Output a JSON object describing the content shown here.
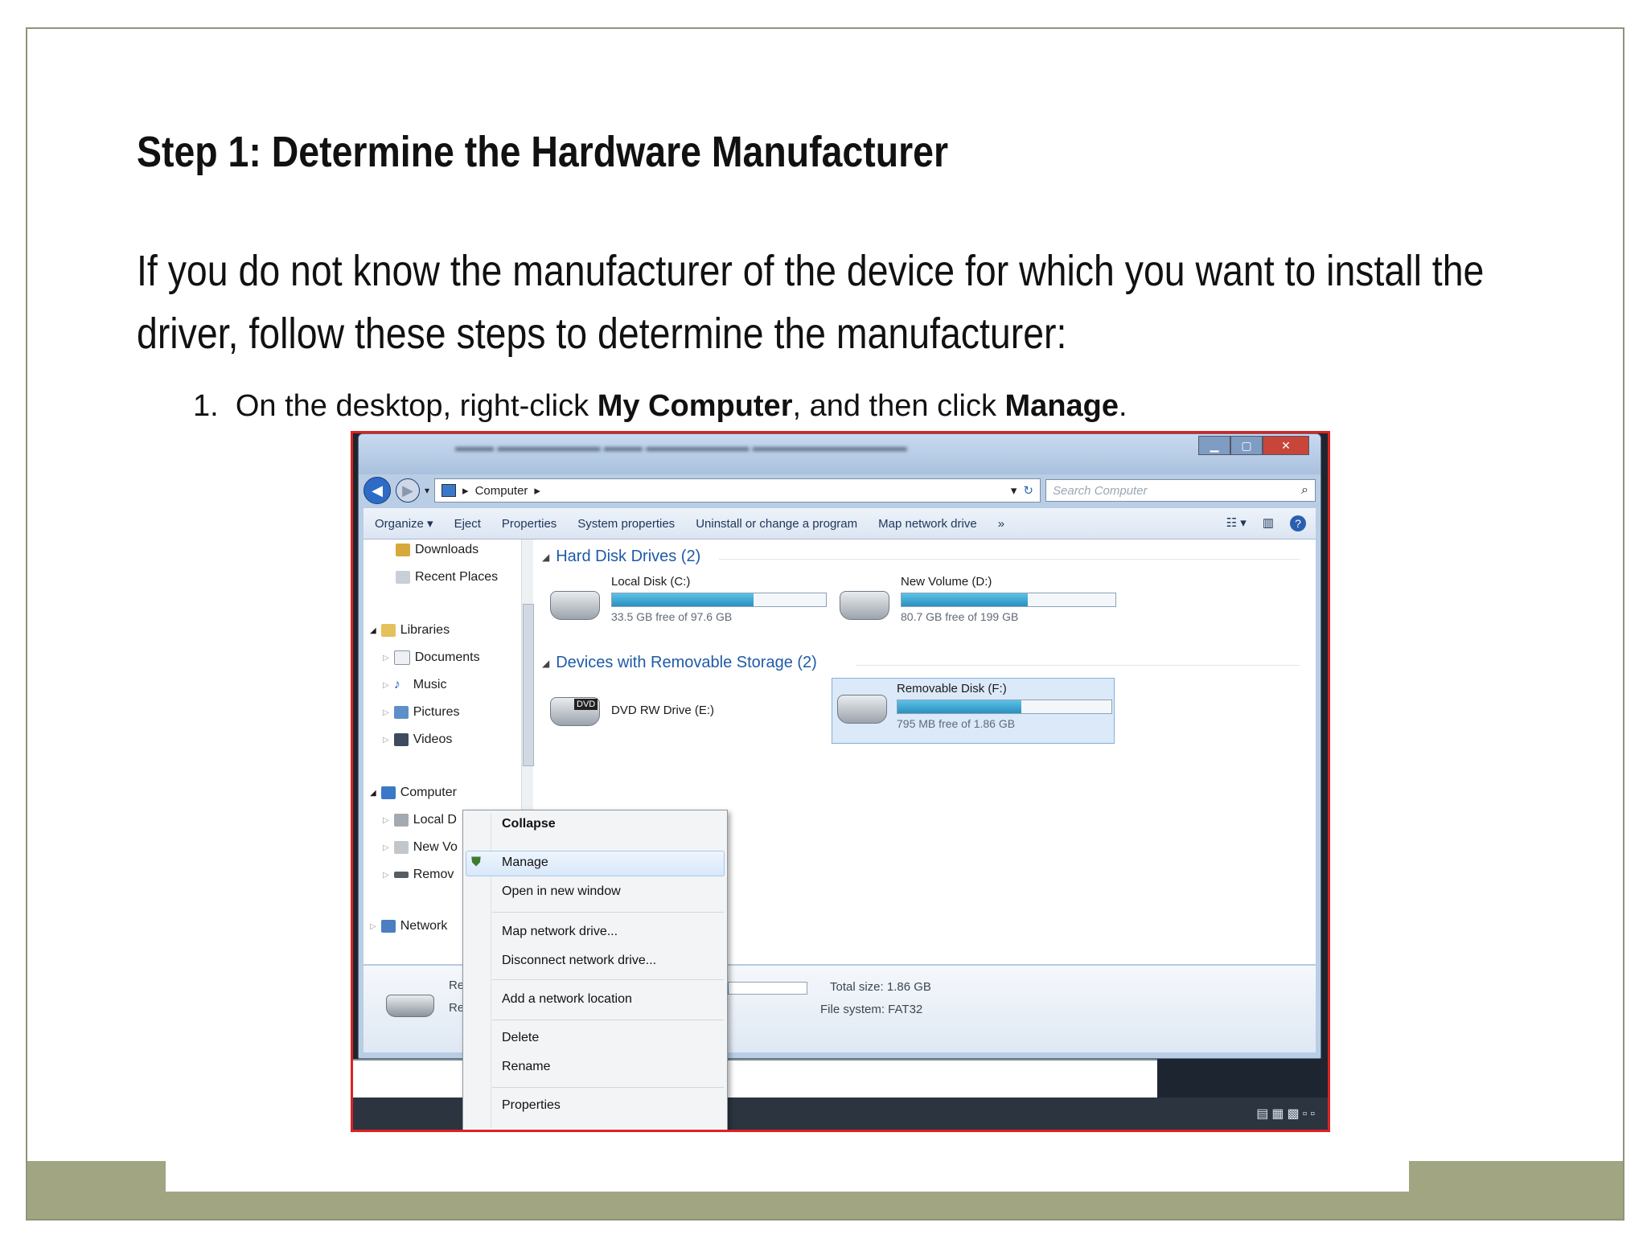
{
  "slide": {
    "title": "Step 1: Determine the Hardware Manufacturer",
    "intro": "If you do not know the manufacturer of the device for which you want to install the driver, follow these steps to determine the manufacturer:",
    "step": {
      "number": "1.",
      "text_before": "On the desktop, right-click ",
      "bold1": "My Computer",
      "text_middle": ", and then click ",
      "bold2": "Manage",
      "text_after": "."
    }
  },
  "explorer": {
    "address": {
      "path": "Computer",
      "separator": "▸"
    },
    "search": {
      "placeholder": "Search Computer"
    },
    "commands": [
      "Organize ▾",
      "Eject",
      "Properties",
      "System properties",
      "Uninstall or change a program",
      "Map network drive",
      "»"
    ],
    "nav": {
      "downloads": "Downloads",
      "recent": "Recent Places",
      "libraries": "Libraries",
      "documents": "Documents",
      "music": "Music",
      "pictures": "Pictures",
      "videos": "Videos",
      "computer": "Computer",
      "local": "Local D",
      "newvol": "New Vo",
      "removable": "Remov",
      "network": "Network"
    },
    "groups": {
      "hdd": "Hard Disk Drives (2)",
      "removable": "Devices with Removable Storage (2)"
    },
    "drives": {
      "c": {
        "name": "Local Disk (C:)",
        "free": "33.5 GB free of 97.6 GB",
        "used_fraction": 0.66
      },
      "d": {
        "name": "New Volume (D:)",
        "free": "80.7 GB free of 199 GB",
        "used_fraction": 0.59
      },
      "e": {
        "name": "DVD RW Drive (E:)",
        "badge": "DVD"
      },
      "f": {
        "name": "Removable Disk (F:)",
        "free": "795 MB free of 1.86 GB",
        "used_fraction": 0.58
      }
    },
    "details": {
      "name_partial": "Re",
      "sub_partial": "Re",
      "total": "Total size: 1.86 GB",
      "fs": "File system: FAT32"
    }
  },
  "context_menu": {
    "collapse": "Collapse",
    "manage": "Manage",
    "open_new": "Open in new window",
    "map_drive": "Map network drive...",
    "disconnect": "Disconnect network drive...",
    "add_location": "Add a network location",
    "delete": "Delete",
    "rename": "Rename",
    "properties": "Properties"
  },
  "colors": {
    "band": "#a1a582",
    "link_blue": "#1e5aa8",
    "highlight": "#d8e8fa"
  }
}
